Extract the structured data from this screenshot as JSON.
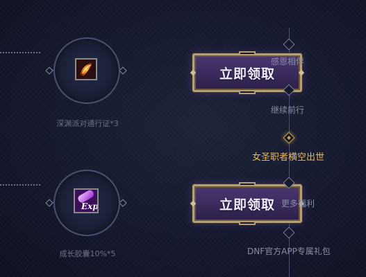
{
  "rewards": [
    {
      "name": "深渊派对通行证*3",
      "icon": "flame-ticket-icon",
      "button_label": "立即领取"
    },
    {
      "name": "成长胶囊10%*5",
      "icon": "exp-capsule-icon",
      "icon_text": "Exp",
      "button_label": "立即领取"
    }
  ],
  "timeline": {
    "items": [
      {
        "label": "感恩相伴",
        "active": false
      },
      {
        "label": "继续前行",
        "active": false
      },
      {
        "label": "女圣职者横空出世",
        "active": true
      },
      {
        "label": "更多福利",
        "active": false
      },
      {
        "label": "DNF官方APP专属礼包",
        "active": false
      }
    ]
  },
  "colors": {
    "background": "#15192a",
    "button_fill": "#3a2a5c",
    "button_border": "#b5a07a",
    "active_accent": "#f0b850"
  }
}
